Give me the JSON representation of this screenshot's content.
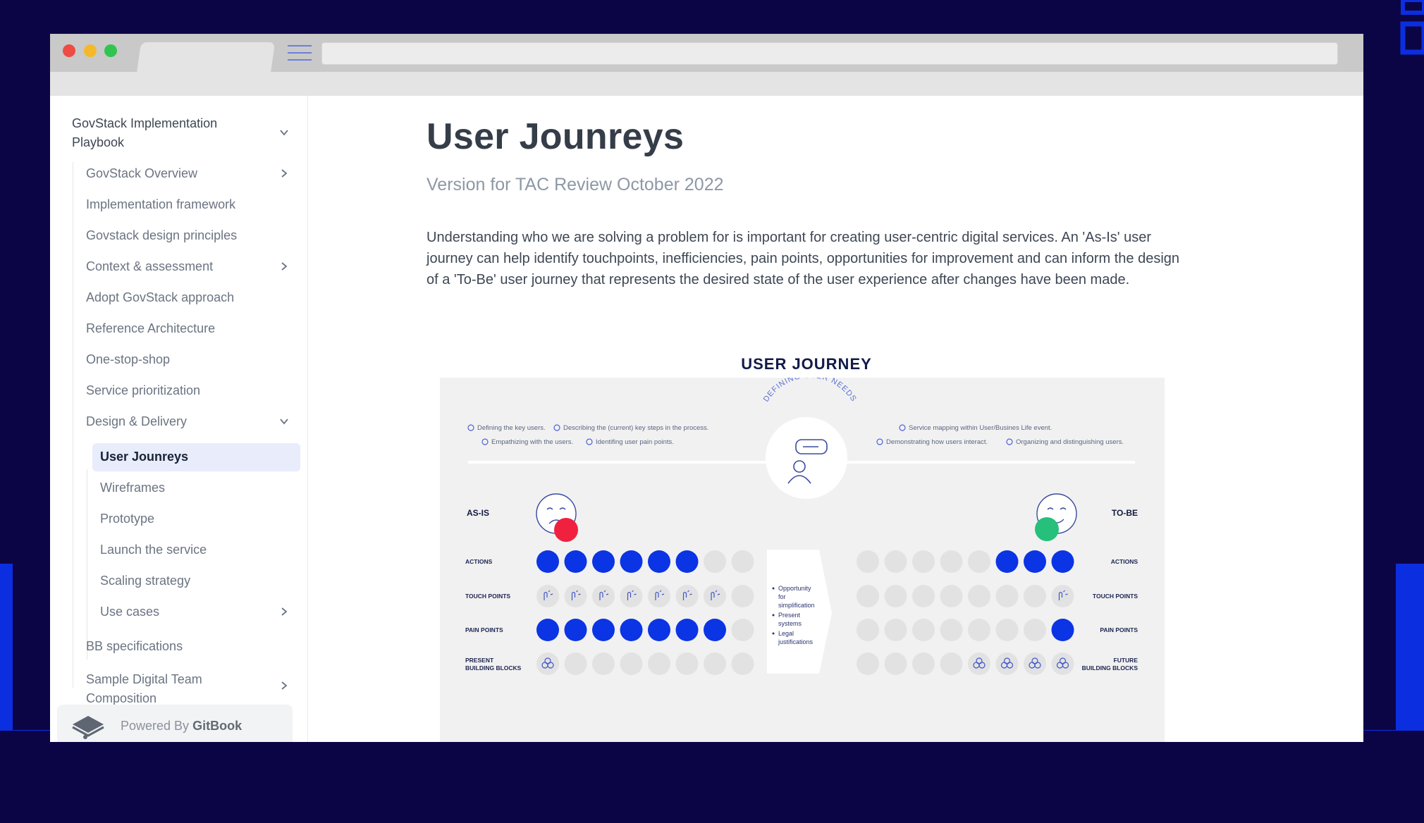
{
  "sidebar": {
    "heading": "GovStack Implementation Playbook",
    "items": [
      {
        "label": "GovStack Overview"
      },
      {
        "label": "Implementation framework"
      },
      {
        "label": "Govstack design principles"
      },
      {
        "label": "Context & assessment"
      },
      {
        "label": "Adopt GovStack approach"
      },
      {
        "label": "Reference Architecture"
      },
      {
        "label": "One-stop-shop"
      },
      {
        "label": "Service prioritization"
      },
      {
        "label": "Design & Delivery"
      },
      {
        "label": "BB specifications"
      },
      {
        "label": "Sample Digital Team Composition"
      }
    ],
    "sub_items": [
      {
        "label": "User Jounreys",
        "active": true
      },
      {
        "label": "Wireframes"
      },
      {
        "label": "Prototype"
      },
      {
        "label": "Launch the service"
      },
      {
        "label": "Scaling strategy"
      },
      {
        "label": "Use cases"
      }
    ],
    "powered_prefix": "Powered By",
    "powered_brand": "GitBook"
  },
  "page": {
    "title": "User Jounreys",
    "subtitle": "Version for TAC Review October 2022",
    "paragraph": "Understanding who we are solving a problem for is important for creating user-centric digital services. An 'As-Is' user journey can help identify touchpoints, inefficiencies, pain points, opportunities for improvement and can inform the design of a 'To-Be' user journey that represents the desired state of the user experience after changes have been made."
  },
  "diagram": {
    "title": "USER JOURNEY",
    "arc_label": "DEFINING USER NEEDS",
    "left_notes": [
      "Defining the key users.",
      "Describing the (current) key steps in the process.",
      "Empathizing with the users.",
      "Identifing user pain points."
    ],
    "right_notes": [
      "Service mapping within User/Busines Life event.",
      "Demonstrating how users interact.",
      "Organizing and distinguishing users."
    ],
    "as_is_label": "AS-IS",
    "to_be_label": "TO-BE",
    "rows": [
      {
        "left": "ACTIONS",
        "right": "ACTIONS"
      },
      {
        "left": "TOUCH POINTS",
        "right": "TOUCH POINTS"
      },
      {
        "left": "PAIN POINTS",
        "right": "PAIN POINTS"
      },
      {
        "left": "PRESENT BUILDING BLOCKS",
        "right": "FUTURE BUILDING BLOCKS"
      }
    ],
    "center_bullets": [
      "Opportunity for simplification",
      "Present systems",
      "Legal justifications"
    ],
    "as_is_fill": [
      "blue",
      "blue",
      "blue",
      "blue",
      "blue",
      "blue",
      "grey",
      "grey"
    ],
    "as_is_touch": [
      "touch",
      "touch",
      "touch",
      "touch",
      "touch",
      "touch",
      "touch",
      "grey"
    ],
    "as_is_pain": [
      "blue",
      "blue",
      "blue",
      "blue",
      "blue",
      "blue",
      "blue",
      "grey"
    ],
    "as_is_bb": [
      "bb",
      "grey",
      "grey",
      "grey",
      "grey",
      "grey",
      "grey",
      "grey"
    ],
    "to_be_fill": [
      "grey",
      "grey",
      "grey",
      "grey",
      "grey",
      "blue",
      "blue",
      "blue"
    ],
    "to_be_touch": [
      "grey",
      "grey",
      "grey",
      "grey",
      "grey",
      "grey",
      "grey",
      "touch"
    ],
    "to_be_pain": [
      "grey",
      "grey",
      "grey",
      "grey",
      "grey",
      "grey",
      "grey",
      "blue"
    ],
    "to_be_bb": [
      "grey",
      "grey",
      "grey",
      "grey",
      "bb",
      "bb",
      "bb",
      "bb"
    ],
    "colors": {
      "blue": "#0b34e4",
      "grey": "#e2e2e2",
      "sad": "#f0213e",
      "happy": "#26c07a"
    }
  }
}
